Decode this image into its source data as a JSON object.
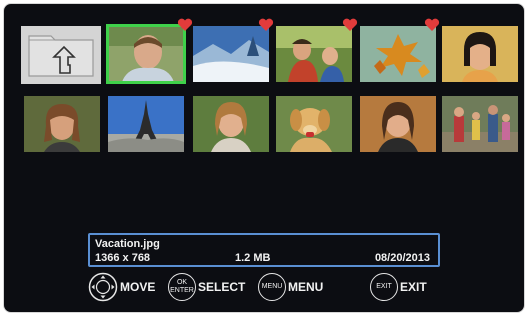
{
  "thumbnails": [
    {
      "name": "folder-up",
      "favorite": false,
      "selected": false
    },
    {
      "name": "photo-boy-portrait",
      "favorite": true,
      "selected": true
    },
    {
      "name": "photo-snow-landscape",
      "favorite": true,
      "selected": false
    },
    {
      "name": "photo-kids-playing",
      "favorite": true,
      "selected": false
    },
    {
      "name": "photo-autumn-leaves",
      "favorite": true,
      "selected": false
    },
    {
      "name": "photo-girl-smiling",
      "favorite": false,
      "selected": false
    },
    {
      "name": "photo-girl-portrait",
      "favorite": false,
      "selected": false
    },
    {
      "name": "photo-eiffel-tower",
      "favorite": false,
      "selected": false
    },
    {
      "name": "photo-woman-smiling",
      "favorite": false,
      "selected": false
    },
    {
      "name": "photo-golden-dog",
      "favorite": false,
      "selected": false
    },
    {
      "name": "photo-woman-laughing",
      "favorite": false,
      "selected": false
    },
    {
      "name": "photo-family-walk",
      "favorite": false,
      "selected": false
    }
  ],
  "info": {
    "filename": "Vacation.jpg",
    "resolution": "1366 x 768",
    "filesize": "1.2 MB",
    "date": "08/20/2013"
  },
  "controls": {
    "move_label": "MOVE",
    "select_label": "SELECT",
    "select_btn_top": "OK",
    "select_btn_bottom": "ENTER",
    "menu_btn": "MENU",
    "menu_label": "MENU",
    "exit_btn": "EXIT",
    "exit_label": "EXIT"
  },
  "colors": {
    "background": "#0c0d12",
    "selection": "#3fd14a",
    "heart": "#e23b3b",
    "info_border": "#5a8fd3"
  }
}
